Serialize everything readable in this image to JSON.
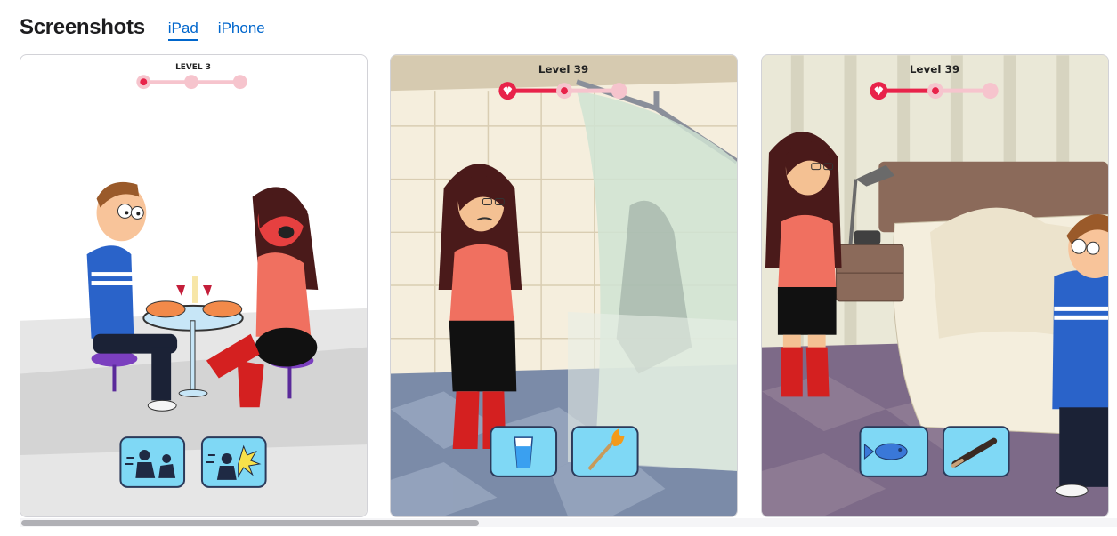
{
  "section": {
    "title": "Screenshots",
    "tabs": [
      {
        "label": "iPad",
        "active": true
      },
      {
        "label": "iPhone",
        "active": false
      }
    ]
  },
  "screenshots": [
    {
      "level_label": "LEVEL 3",
      "progress_dots": 3,
      "current_step": 1,
      "actions": [
        "push-icon",
        "slap-icon"
      ]
    },
    {
      "level_label": "Level 39",
      "progress_dots": 3,
      "current_step": 2,
      "actions": [
        "water-glass-icon",
        "torch-icon"
      ]
    },
    {
      "level_label": "Level 39",
      "progress_dots": 3,
      "current_step": 2,
      "actions": [
        "fish-icon",
        "baseball-bat-icon"
      ]
    }
  ],
  "colors": {
    "link": "#0066cc",
    "progress": "#e8234a",
    "action_bg": "#7fd8f5",
    "shirt_blue": "#2a63c9",
    "dress_red": "#f07060"
  },
  "scroll": {
    "position": 0.0
  }
}
